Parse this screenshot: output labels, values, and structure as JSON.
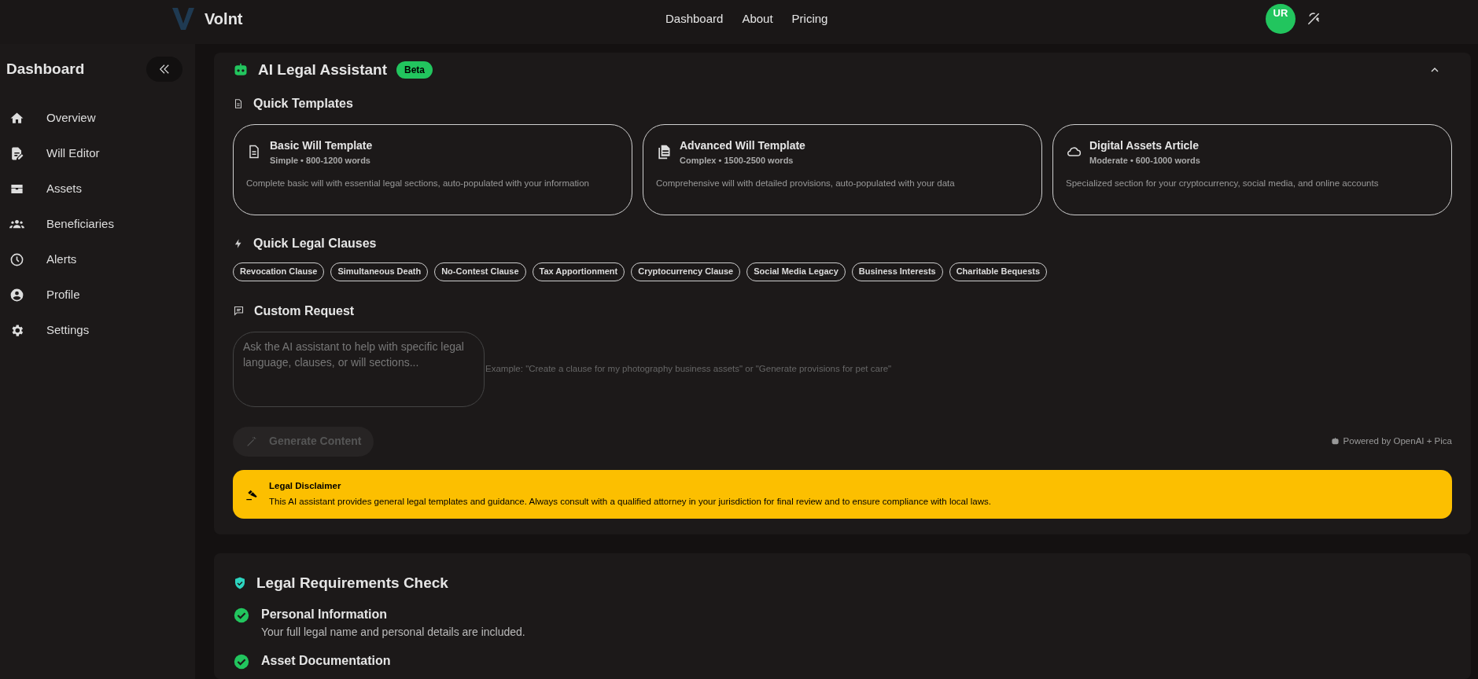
{
  "header": {
    "brand": "Volnt",
    "nav": [
      "Dashboard",
      "About",
      "Pricing"
    ],
    "avatar": "UR"
  },
  "sidebar": {
    "title": "Dashboard",
    "items": [
      {
        "label": "Overview"
      },
      {
        "label": "Will Editor"
      },
      {
        "label": "Assets"
      },
      {
        "label": "Beneficiaries"
      },
      {
        "label": "Alerts"
      },
      {
        "label": "Profile"
      },
      {
        "label": "Settings"
      }
    ]
  },
  "assistant": {
    "title": "AI Legal Assistant",
    "badge": "Beta",
    "expanded": true,
    "templates_heading": "Quick Templates",
    "templates": [
      {
        "title": "Basic Will Template",
        "meta": "Simple • 800-1200 words",
        "description": "Complete basic will with essential legal sections, auto-populated with your information"
      },
      {
        "title": "Advanced Will Template",
        "meta": "Complex • 1500-2500 words",
        "description": "Comprehensive will with detailed provisions, auto-populated with your data"
      },
      {
        "title": "Digital Assets Article",
        "meta": "Moderate • 600-1000 words",
        "description": "Specialized section for your cryptocurrency, social media, and online accounts"
      }
    ],
    "clauses_heading": "Quick Legal Clauses",
    "clauses": [
      "Revocation Clause",
      "Simultaneous Death",
      "No-Contest Clause",
      "Tax Apportionment",
      "Cryptocurrency Clause",
      "Social Media Legacy",
      "Business Interests",
      "Charitable Bequests"
    ],
    "custom_heading": "Custom Request",
    "request": {
      "placeholder": "Ask the AI assistant to help with specific legal language, clauses, or will sections..."
    },
    "example": "Example: \"Create a clause for my photography business assets\" or \"Generate provisions for pet care\"",
    "generate": {
      "label": "Generate Content",
      "disabled": true
    },
    "powered_by": "Powered by OpenAI + Pica",
    "disclaimer": {
      "title": "Legal Disclaimer",
      "text": "This AI assistant provides general legal templates and guidance. Always consult with a qualified attorney in your jurisdiction for final review and to ensure compliance with local laws."
    }
  },
  "requirements": {
    "title": "Legal Requirements Check",
    "items": [
      {
        "title": "Personal Information",
        "description": "Your full legal name and personal details are included.",
        "done": true
      },
      {
        "title": "Asset Documentation",
        "done": true
      }
    ]
  }
}
